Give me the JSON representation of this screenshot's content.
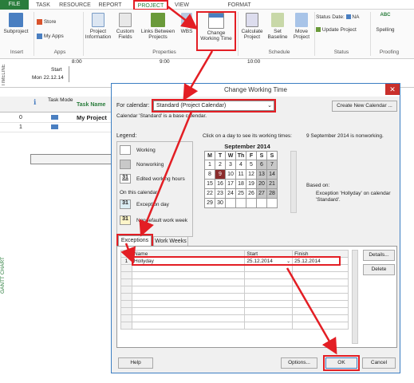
{
  "tabs": {
    "file": "FILE",
    "task": "TASK",
    "resource": "RESOURCE",
    "report": "REPORT",
    "project": "PROJECT",
    "view": "VIEW",
    "format": "FORMAT"
  },
  "ribbon": {
    "subproject": "Subproject",
    "store": "Store",
    "myapps": "My Apps",
    "project_info": "Project Information",
    "custom_fields": "Custom Fields",
    "links": "Links Between Projects",
    "wbs": "WBS",
    "change_working_time": "Change Working Time",
    "calculate": "Calculate Project",
    "set_baseline": "Set Baseline",
    "move": "Move Project",
    "status_date_label": "Status Date:",
    "status_date_value": "NA",
    "update_project": "Update Project",
    "spelling": "Spelling",
    "groups": {
      "insert": "Insert",
      "apps": "Apps",
      "properties": "Properties",
      "schedule": "Schedule",
      "status": "Status",
      "proofing": "Proofing"
    }
  },
  "timeline": {
    "label": "TIMELINE",
    "start_label": "Start",
    "start_date": "Mon 22.12.14",
    "t1": "8:00",
    "t2": "9:00",
    "t3": "10:00"
  },
  "grid": {
    "col_task_mode": "Task Mode",
    "col_task_name": "Task Name",
    "row0_id": "0",
    "row0_name": "My Project",
    "row1_id": "1",
    "side_label": "GANTT CHART"
  },
  "dialog": {
    "title": "Change Working Time",
    "for_calendar_label": "For calendar:",
    "calendar_value": "Standard (Project Calendar)",
    "create_new": "Create New Calendar ...",
    "base_info": "Calendar 'Standard' is a base calendar.",
    "legend_label": "Legend:",
    "legend": {
      "working": "Working",
      "nonworking": "Nonworking",
      "edited": "Edited working hours",
      "on_this": "On this calendar:",
      "exception": "Exception day",
      "nondefault": "Nondefault work week",
      "num": "31"
    },
    "click_info": "Click on a day to see its working times:",
    "month": "September 2014",
    "weekdays": [
      "M",
      "T",
      "W",
      "Th",
      "F",
      "S",
      "S"
    ],
    "weeks": [
      [
        "1",
        "2",
        "3",
        "4",
        "5",
        "6",
        "7"
      ],
      [
        "8",
        "9",
        "10",
        "11",
        "12",
        "13",
        "14"
      ],
      [
        "15",
        "16",
        "17",
        "18",
        "19",
        "20",
        "21"
      ],
      [
        "22",
        "23",
        "24",
        "25",
        "26",
        "27",
        "28"
      ],
      [
        "29",
        "30",
        "",
        "",
        "",
        "",
        ""
      ]
    ],
    "day_info": "9 September 2014 is nonworking.",
    "based_on": "Based on:",
    "based_on_detail": "Exception 'Hollyday' on calendar 'Standard'.",
    "tab_exceptions": "Exceptions",
    "tab_work_weeks": "Work Weeks",
    "col_name": "Name",
    "col_start": "Start",
    "col_finish": "Finish",
    "exception_row": {
      "id": "1",
      "name": "Hollyday",
      "start": "25.12.2014",
      "finish": "25.12.2014"
    },
    "details": "Details...",
    "delete": "Delete",
    "help": "Help",
    "options": "Options...",
    "ok": "OK",
    "cancel": "Cancel"
  },
  "colors": {
    "accent": "#2a7d3c",
    "highlight": "#e31e24",
    "selected_day": "#8b2c2c",
    "dialog_border": "#3c7ec2"
  }
}
